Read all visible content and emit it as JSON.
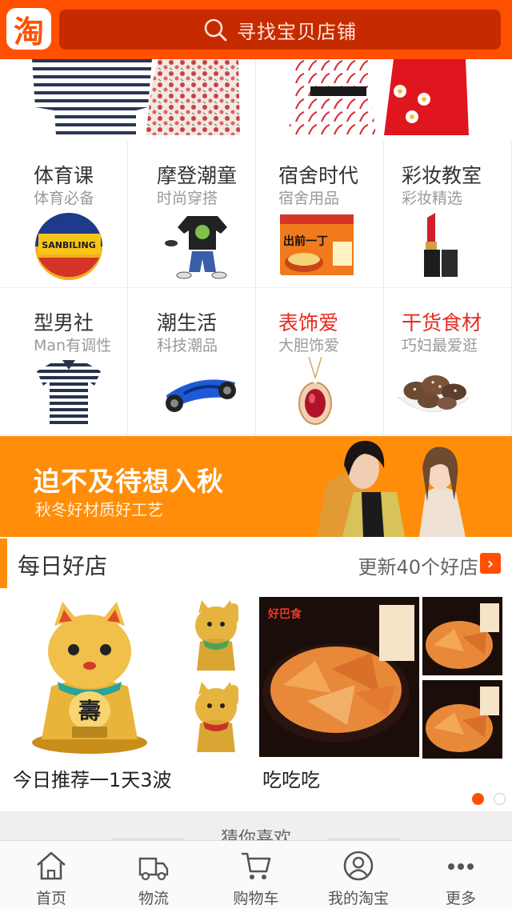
{
  "header": {
    "logo_char": "淘",
    "search_placeholder": "寻找宝贝店铺"
  },
  "categories": [
    {
      "title": "体育课",
      "subtitle": "体育必备",
      "image": "basketball",
      "image_text": "SANBILING"
    },
    {
      "title": "摩登潮童",
      "subtitle": "时尚穿搭",
      "image": "kids-outfit"
    },
    {
      "title": "宿舍时代",
      "subtitle": "宿舍用品",
      "image": "instant-noodles",
      "image_text": "出前一丁"
    },
    {
      "title": "彩妆教室",
      "subtitle": "彩妆精选",
      "image": "lipstick"
    },
    {
      "title": "型男社",
      "subtitle": "Man有调性",
      "image": "striped-polo"
    },
    {
      "title": "潮生活",
      "subtitle": "科技潮品",
      "image": "hoverboard"
    },
    {
      "title": "表饰爱",
      "subtitle": "大胆饰爱",
      "image": "ruby-pendant"
    },
    {
      "title": "干货食材",
      "subtitle": "巧妇最爱逛",
      "image": "dried-mushrooms"
    }
  ],
  "banner": {
    "headline": "迫不及待想入秋",
    "subline": "秋冬好材质好工艺"
  },
  "daily_shops": {
    "title": "每日好店",
    "more_text": "更新40个好店",
    "shops": [
      {
        "caption": "今日推荐一1天3波",
        "image": "lucky-cat"
      },
      {
        "caption": "吃吃吃",
        "image": "spicy-snacks",
        "brand_text": "好巴食"
      }
    ],
    "active_page": 1,
    "page_count": 2
  },
  "guess_you_like": {
    "label": "猜你喜欢"
  },
  "tabs": [
    {
      "label": "首页",
      "icon": "home-icon"
    },
    {
      "label": "物流",
      "icon": "truck-icon"
    },
    {
      "label": "购物车",
      "icon": "cart-icon"
    },
    {
      "label": "我的淘宝",
      "icon": "profile-icon"
    },
    {
      "label": "更多",
      "icon": "more-icon"
    }
  ],
  "colors": {
    "brand": "#ff5000",
    "search_bg": "#c62b00",
    "banner": "#ff8d0a",
    "highlight_text": "#e8291f"
  }
}
